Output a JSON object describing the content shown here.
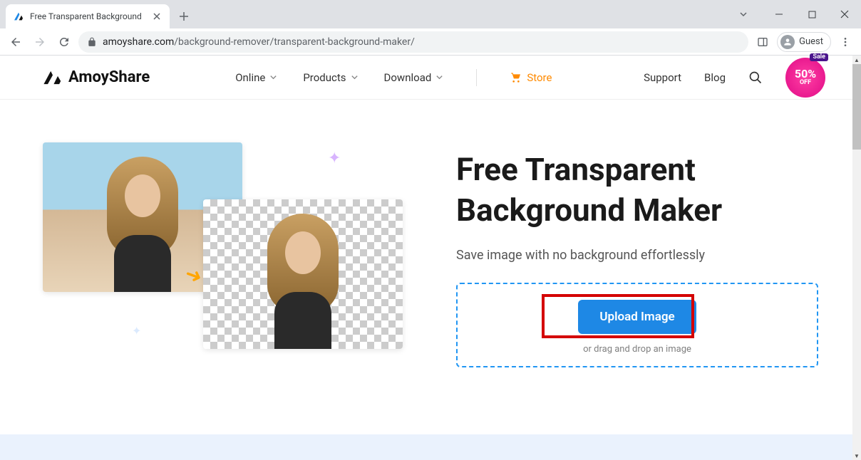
{
  "browser": {
    "tab_title": "Free Transparent Background",
    "url_host": "amoyshare.com",
    "url_path": "/background-remover/transparent-background-maker/",
    "guest_label": "Guest"
  },
  "header": {
    "brand": "AmoyShare",
    "nav": {
      "online": "Online",
      "products": "Products",
      "download": "Download",
      "store": "Store",
      "support": "Support",
      "blog": "Blog"
    },
    "sale": {
      "tag": "Sale",
      "pct": "50%",
      "off": "OFF"
    }
  },
  "hero": {
    "title_line1": "Free Transparent",
    "title_line2": "Background Maker",
    "subtitle": "Save image with no background effortlessly",
    "upload_button": "Upload Image",
    "upload_hint": "or drag and drop an image"
  }
}
